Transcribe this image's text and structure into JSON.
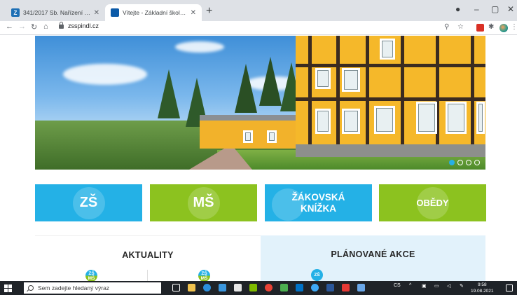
{
  "browser": {
    "tabs": [
      {
        "title": "341/2017 Sb. Nařízení vlády o pl…",
        "favicon": "Z",
        "active": false
      },
      {
        "title": "Vítejte - Základní škola a mateřsk…",
        "favicon": "",
        "active": true
      }
    ],
    "url": "zsspindl.cz",
    "new_tab_icon": "plus-icon",
    "window_controls": {
      "minimize": "–",
      "maximize": "▢",
      "close": "✕"
    }
  },
  "hero": {
    "slides_total": 4,
    "active_slide": 1
  },
  "tiles": [
    {
      "label": "ZŠ",
      "color": "#24b1e6"
    },
    {
      "label": "MŠ",
      "color": "#8cc21f"
    },
    {
      "label_line1": "ŽÁKOVSKÁ",
      "label_line2": "KNÍŽKA",
      "color": "#24b1e6"
    },
    {
      "label": "OBĚDY",
      "color": "#8cc21f"
    }
  ],
  "panels": {
    "news_title": "AKTUALITY",
    "events_title": "PLÁNOVANÉ AKCE",
    "badge_zs": "ZŠ",
    "badge_ms": "MŠ"
  },
  "taskbar": {
    "search_placeholder": "Sem zadejte hledaný výraz",
    "lang": "CS",
    "time": "9:58",
    "date": "19.08.2021"
  },
  "colors": {
    "brand_blue": "#24b1e6",
    "brand_green": "#8cc21f",
    "events_panel_bg": "#e2f2fb"
  }
}
